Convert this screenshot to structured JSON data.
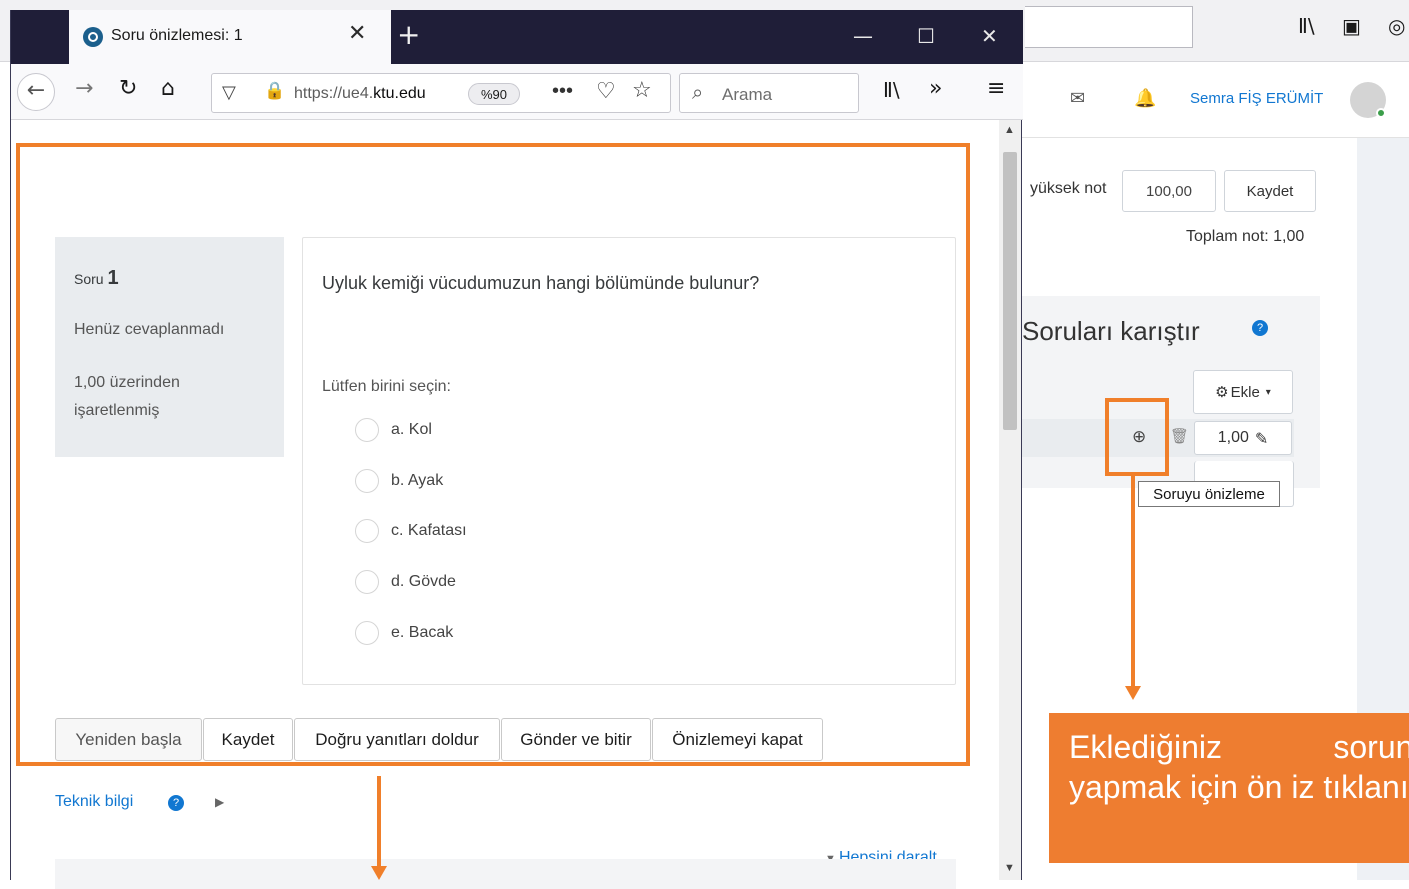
{
  "background": {
    "user_name": "Semra FİŞ ERÜMİT",
    "highest_grade_label": "yüksek not",
    "highest_grade_value": "100,00",
    "save_button": "Kaydet",
    "total_grade": "Toplam not: 1,00",
    "shuffle_label": "Soruları karıştır",
    "add_button": "Ekle",
    "question_grade": "1,00",
    "tooltip": "Soruyu önizleme"
  },
  "popup": {
    "tab_title": "Soru önizlemesi: 1",
    "url": "https://ue4.ktu.edu",
    "url_host": "ktu.edu",
    "url_prefix": "https://ue4.",
    "zoom": "%90",
    "search_placeholder": "Arama"
  },
  "question": {
    "label_prefix": "Soru",
    "number": "1",
    "status": "Henüz cevaplanmadı",
    "marks_line1": "1,00 üzerinden",
    "marks_line2": "işaretlenmiş",
    "text": "Uyluk kemiği vücudumuzun hangi bölümünde bulunur?",
    "prompt": "Lütfen birini seçin:",
    "options": [
      "a. Kol",
      "b. Ayak",
      "c. Kafatası",
      "d. Gövde",
      "e. Bacak"
    ]
  },
  "buttons": {
    "restart": "Yeniden başla",
    "save": "Kaydet",
    "fill_correct": "Doğru yanıtları doldur",
    "submit": "Gönder ve bitir",
    "close_preview": "Önizlemeyi kapat"
  },
  "footer": {
    "tech_info": "Teknik bilgi",
    "collapse_all": "Hepsini daralt"
  },
  "callout": {
    "text": "Eklediğiniz sorunun yapmak için ön iz tıklanır."
  },
  "colors": {
    "accent_orange": "#f07f2a",
    "link_blue": "#1177d1",
    "browser_dark": "#1f1e38"
  }
}
